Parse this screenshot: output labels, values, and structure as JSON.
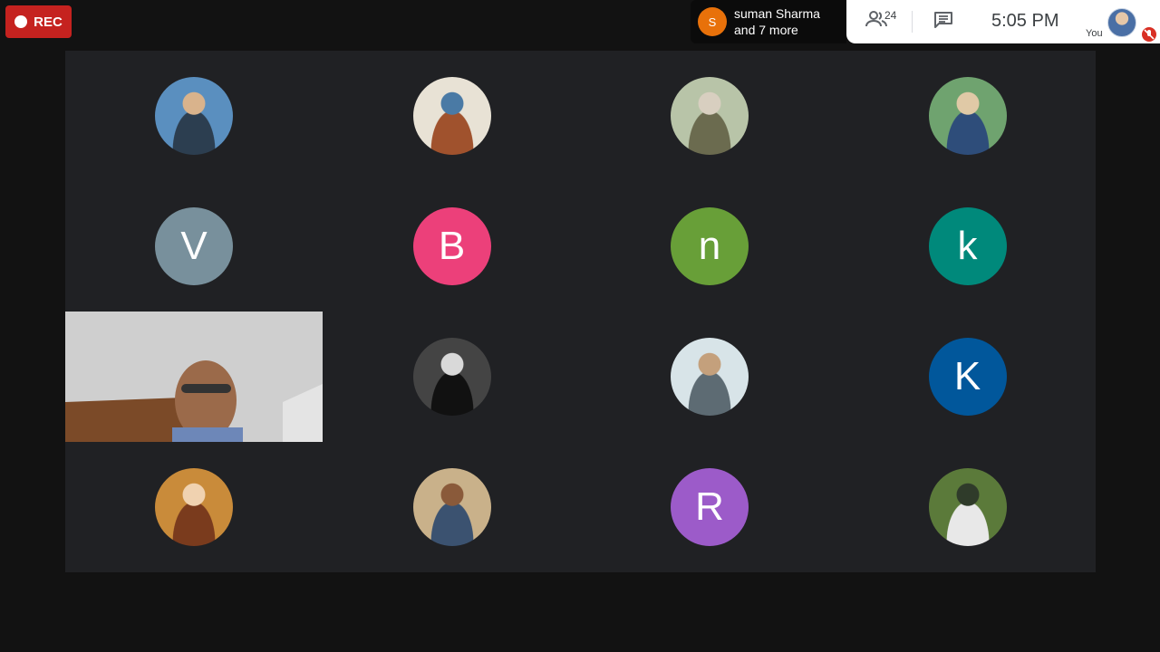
{
  "recording": {
    "label": "REC"
  },
  "notification": {
    "avatar_letter": "S",
    "line1": "suman Sharma",
    "line2": "and 7 more"
  },
  "toolbar": {
    "participant_count": "24",
    "time": "5:05  PM",
    "self_label": "You"
  },
  "participants": [
    {
      "type": "photo",
      "icon": "participant-photo"
    },
    {
      "type": "photo",
      "icon": "participant-photo"
    },
    {
      "type": "photo",
      "icon": "participant-photo"
    },
    {
      "type": "photo",
      "icon": "participant-photo"
    },
    {
      "type": "initial",
      "initial": "V",
      "color": "#78909c"
    },
    {
      "type": "initial",
      "initial": "B",
      "color": "#ec407a"
    },
    {
      "type": "initial",
      "initial": "n",
      "color": "#689f38"
    },
    {
      "type": "initial",
      "initial": "k",
      "color": "#00897b"
    },
    {
      "type": "video",
      "icon": "live-video"
    },
    {
      "type": "photo",
      "icon": "participant-photo"
    },
    {
      "type": "photo",
      "icon": "participant-photo"
    },
    {
      "type": "initial",
      "initial": "K",
      "color": "#01579b"
    },
    {
      "type": "photo",
      "icon": "participant-photo"
    },
    {
      "type": "photo",
      "icon": "participant-photo"
    },
    {
      "type": "initial",
      "initial": "R",
      "color": "#9c5bc9"
    },
    {
      "type": "photo",
      "icon": "participant-photo"
    }
  ]
}
